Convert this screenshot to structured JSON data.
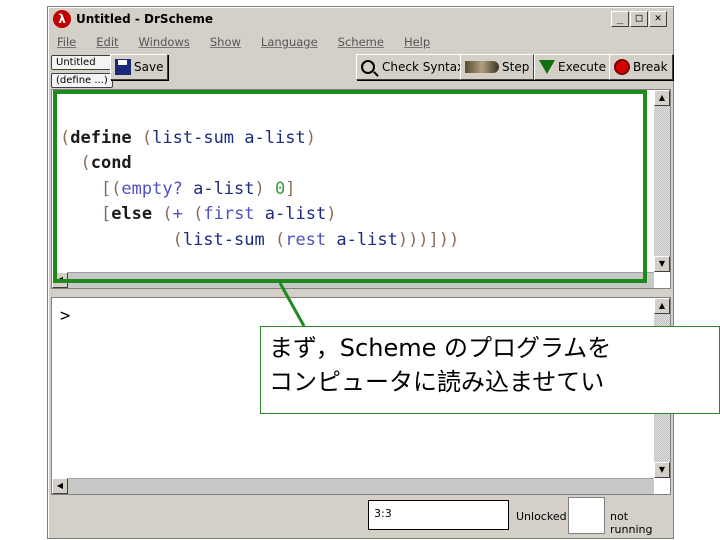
{
  "window": {
    "title": "Untitled - DrScheme",
    "app_icon_glyph": "λ",
    "buttons": {
      "minimize": "_",
      "maximize": "□",
      "close": "✕"
    }
  },
  "menubar": [
    "File",
    "Edit",
    "Windows",
    "Show",
    "Language",
    "Scheme",
    "Help"
  ],
  "tabs": {
    "file_label": "Untitled",
    "def_label": "(define ...)"
  },
  "toolbar": {
    "save_label": "Save",
    "check_syntax_label": "Check Syntax",
    "step_label": "Step",
    "execute_label": "Execute",
    "break_label": "Break"
  },
  "definitions": {
    "lines": [
      [
        "(",
        "define",
        " (",
        "list-sum",
        " ",
        "a-list",
        ")"
      ],
      [
        "  (",
        "cond"
      ],
      [
        "    [(",
        "empty?",
        " ",
        "a-list",
        ") ",
        "0",
        "]"
      ],
      [
        "    [",
        "else",
        " (",
        "+",
        " (",
        "first",
        " ",
        "a-list",
        ")"
      ],
      [
        "           (",
        "list-sum",
        " (",
        "rest",
        " ",
        "a-list",
        ")))]))"
      ]
    ]
  },
  "interactions": {
    "prompt": ">"
  },
  "status": {
    "position": "3:3",
    "lock": "Unlocked",
    "running": "not running"
  },
  "annotation": {
    "line1": "まず，Scheme のプログラムを",
    "line2": "コンピュータに読み込ませてい",
    "color": "#1e8a1e"
  }
}
